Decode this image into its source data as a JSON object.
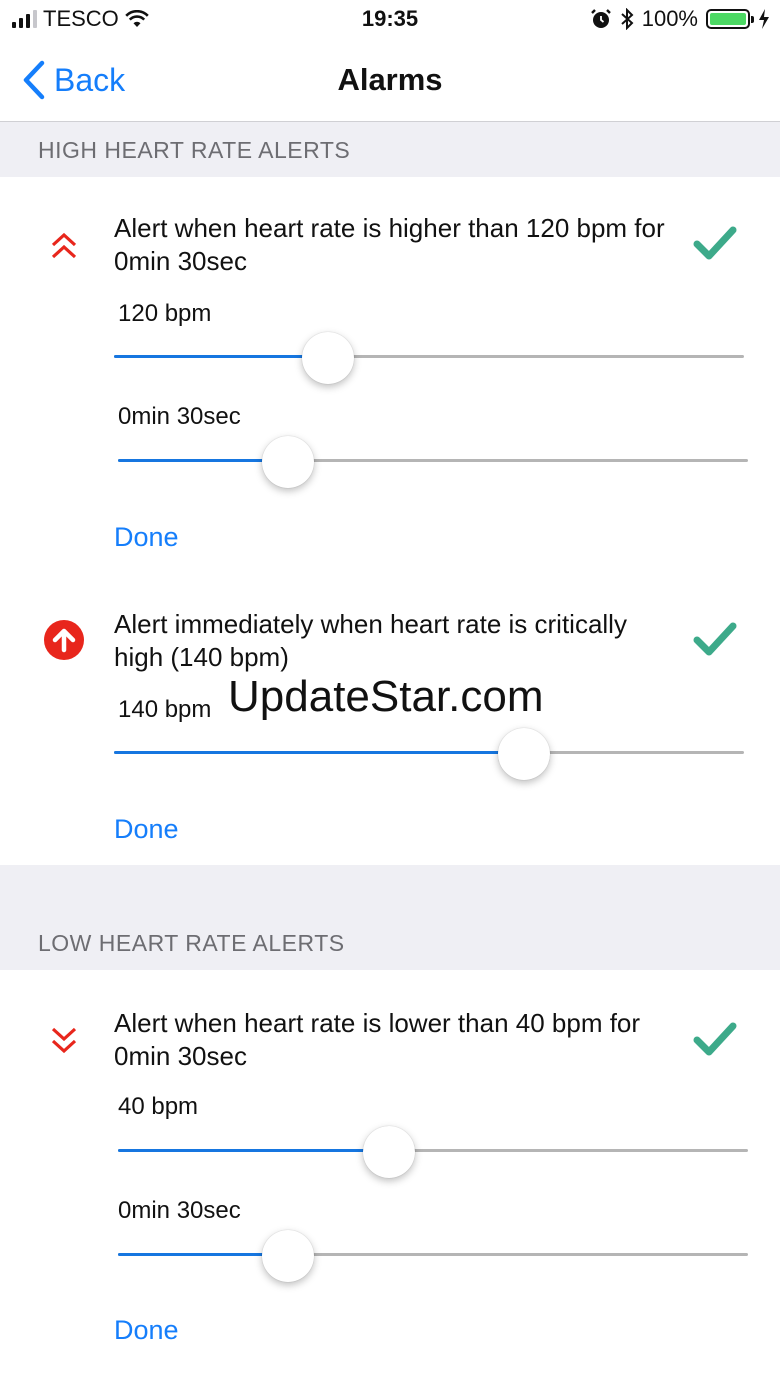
{
  "status_bar": {
    "carrier": "TESCO",
    "time": "19:35",
    "battery_percent": "100%",
    "icons": [
      "signal-icon",
      "wifi-icon",
      "alarm-clock-icon",
      "bluetooth-icon",
      "battery-icon",
      "charging-icon"
    ]
  },
  "nav": {
    "back_label": "Back",
    "title": "Alarms"
  },
  "high_section": {
    "header": "HIGH HEART RATE ALERTS",
    "alerts": [
      {
        "icon": "double-chevron-up-icon",
        "text": "Alert when heart rate is higher than 120 bpm for 0min 30sec",
        "enabled": true,
        "sliders": [
          {
            "label": "120 bpm",
            "fraction": 0.34
          },
          {
            "label": "0min 30sec",
            "fraction": 0.27
          }
        ],
        "done_label": "Done"
      },
      {
        "icon": "arrow-up-circle-icon",
        "text": "Alert immediately when heart rate is critically high (140 bpm)",
        "enabled": true,
        "sliders": [
          {
            "label": "140 bpm",
            "fraction": 0.65
          }
        ],
        "done_label": "Done"
      }
    ]
  },
  "low_section": {
    "header": "LOW HEART RATE ALERTS",
    "alerts": [
      {
        "icon": "double-chevron-down-icon",
        "text": "Alert when heart rate is lower than 40 bpm for 0min 30sec",
        "enabled": true,
        "sliders": [
          {
            "label": "40 bpm",
            "fraction": 0.43
          },
          {
            "label": "0min 30sec",
            "fraction": 0.27
          }
        ],
        "done_label": "Done"
      }
    ]
  },
  "watermark": "UpdateStar.com",
  "colors": {
    "accent": "#157efb",
    "slider_fill": "#1676e0",
    "check": "#3daa8a",
    "alert_red": "#e8261c",
    "section_bg": "#efeff4"
  }
}
